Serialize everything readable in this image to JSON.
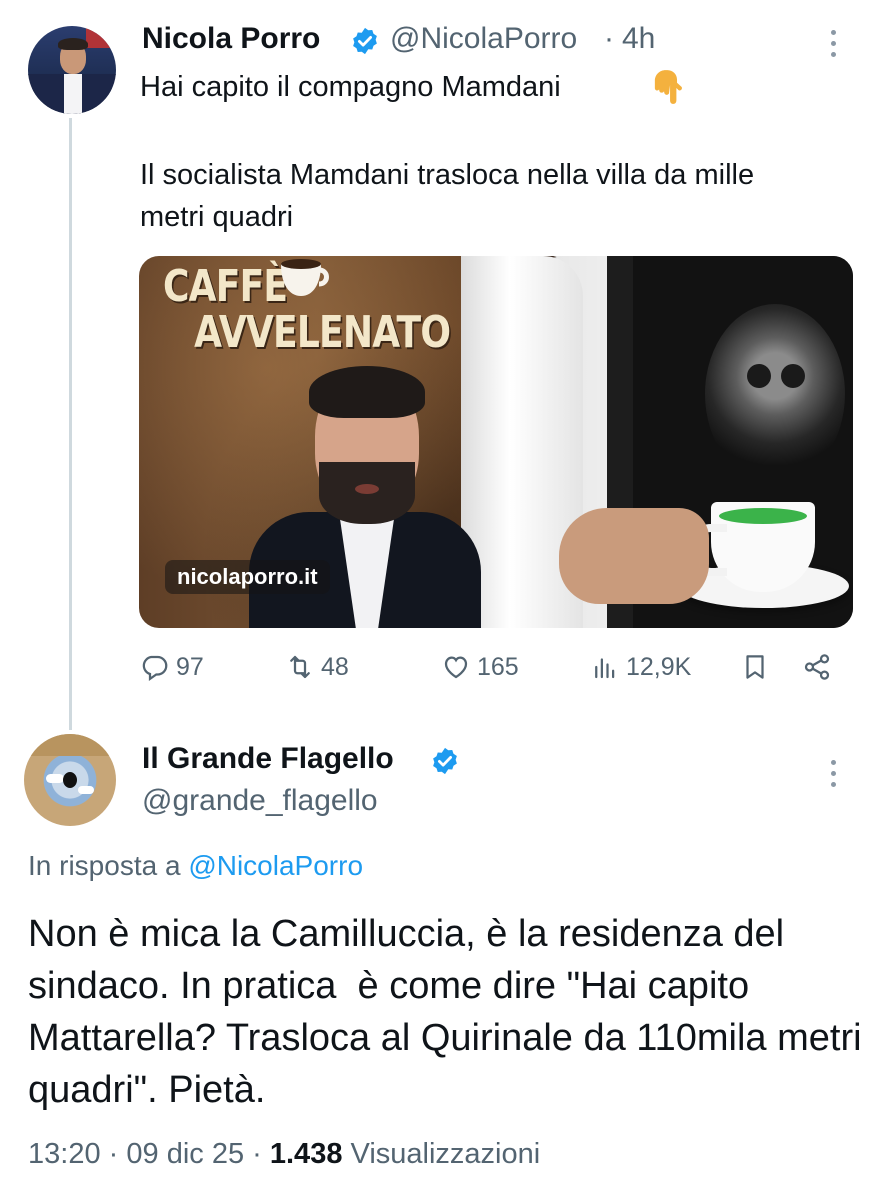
{
  "tweet": {
    "author_name": "Nicola Porro",
    "author_handle": "@NicolaPorro",
    "time_separator": "·",
    "time": "4h",
    "text_line1": "Hai capito il compagno Mamdani",
    "text_line2": "Il socialista Mamdani trasloca nella villa da mille metri quadri",
    "media": {
      "title_line1": "CAFFÈ",
      "title_line2": "AVVELENATO",
      "watermark": "nicolaporro.it"
    },
    "actions": {
      "replies": "97",
      "retweets": "48",
      "likes": "165",
      "views": "12,9K"
    }
  },
  "reply": {
    "author_name": "Il Grande Flagello",
    "author_handle": "@grande_flagello",
    "context_prefix": "In risposta a",
    "context_handle": "@NicolaPorro",
    "text": "Non è mica la Camilluccia, è la residenza del sindaco. In pratica  è come dire \"Hai capito Mattarella? Trasloca al Quirinale da 110mila metri quadri\". Pietà.",
    "time": "13:20",
    "date": "09 dic 25",
    "separator": "·",
    "views_count": "1.438",
    "views_label": "Visualizzazioni"
  },
  "icons": {
    "verified": "verified-badge-icon",
    "more": "more-vertical-icon",
    "pointing": "pointing-down-emoji",
    "reply": "reply-icon",
    "retweet": "retweet-icon",
    "like": "heart-icon",
    "views": "views-chart-icon",
    "bookmark": "bookmark-icon",
    "share": "share-icon"
  },
  "colors": {
    "link": "#1d9bf0",
    "secondary_text": "#536471",
    "primary_text": "#0f1419"
  }
}
